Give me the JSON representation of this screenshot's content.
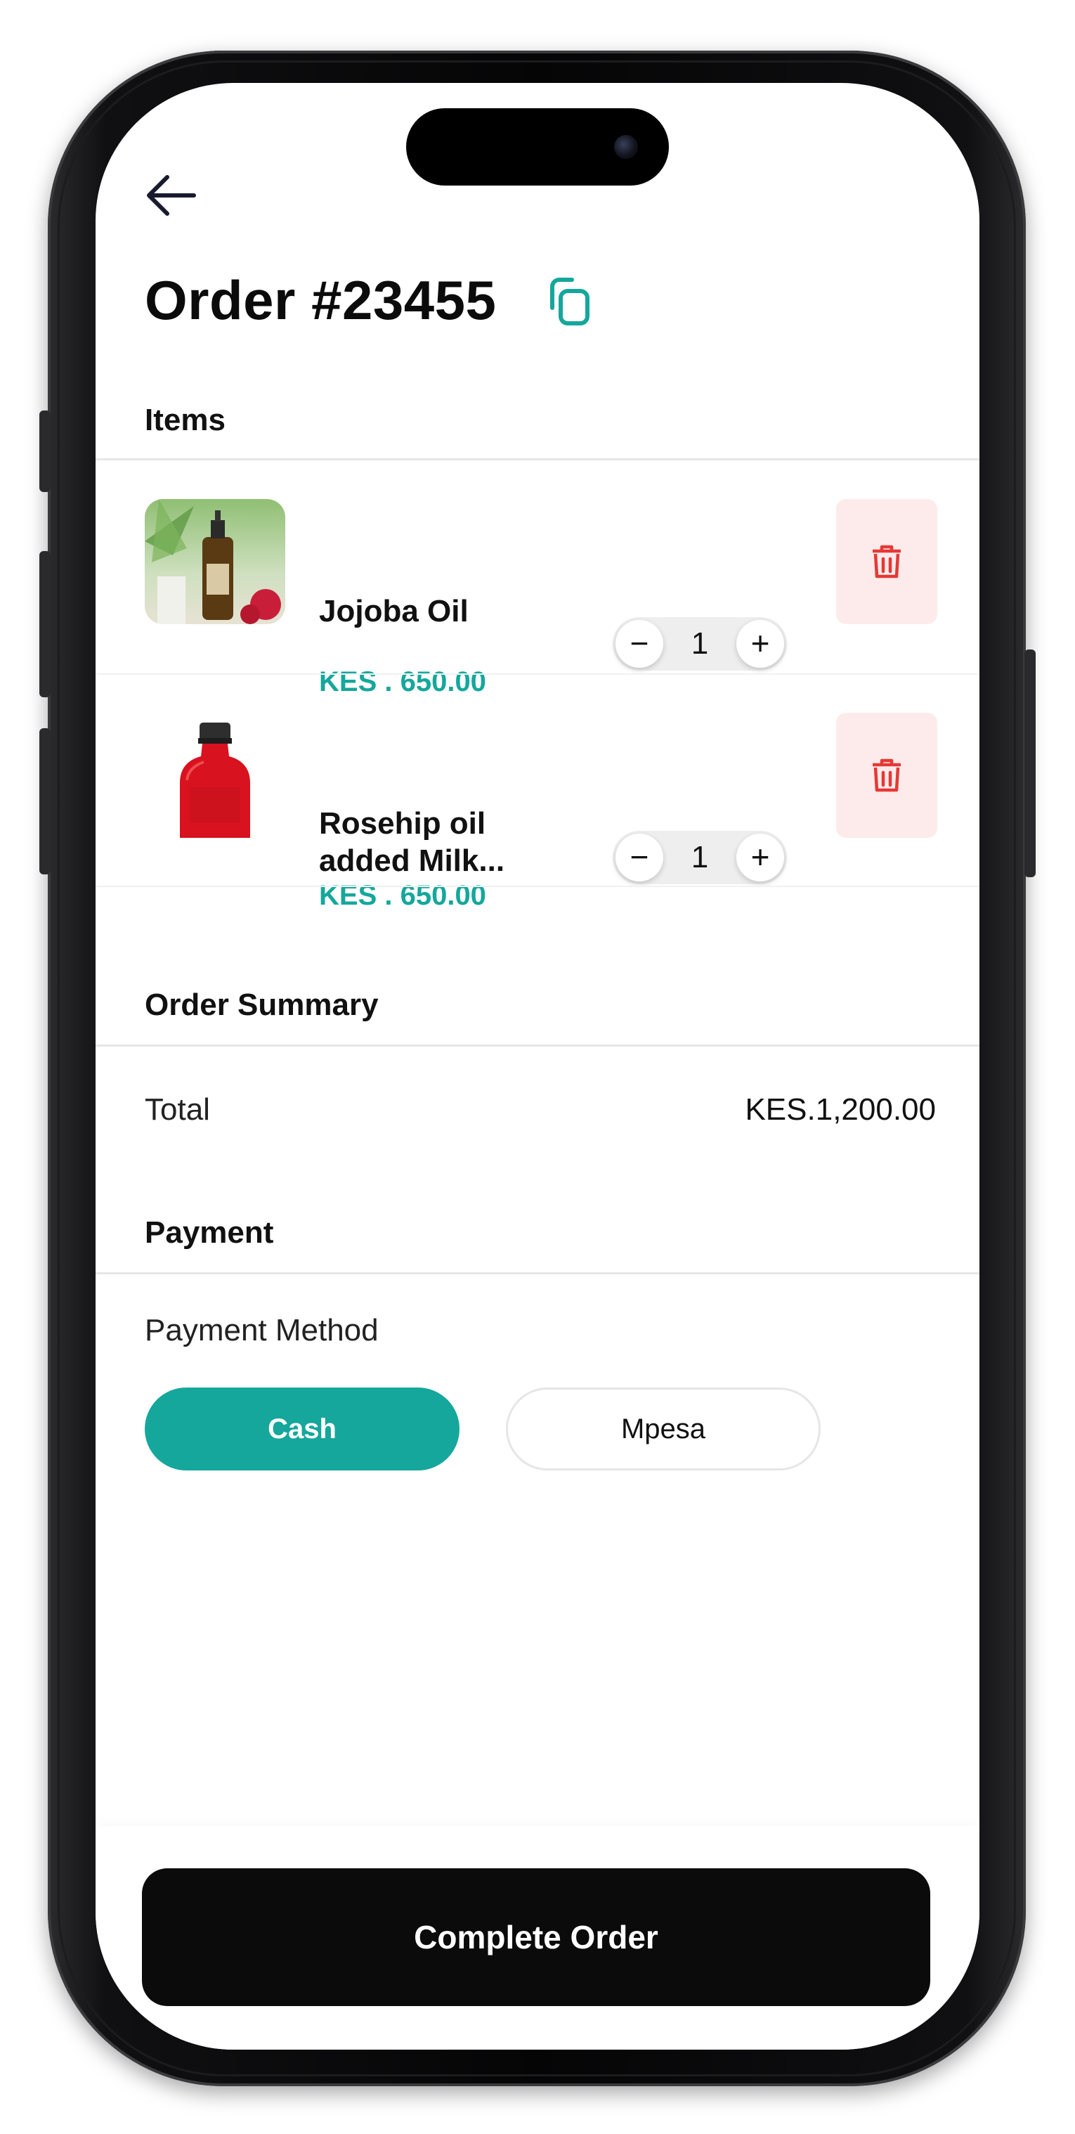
{
  "header": {
    "back_icon": "arrow-left-icon",
    "title": "Order #23455",
    "copy_icon": "copy-icon",
    "accent_color": "#15a79c"
  },
  "items_section": {
    "title": "Items",
    "items": [
      {
        "name": "Jojoba Oil",
        "price": "KES . 650.00",
        "quantity": "1",
        "thumbnail": "jojoba-oil-bottle-image"
      },
      {
        "name": "Rosehip oil added Milk...",
        "price": "KES . 650.00",
        "quantity": "1",
        "thumbnail": "rosehip-oil-bottle-image"
      }
    ],
    "stepper_minus": "−",
    "stepper_plus": "+",
    "delete_icon": "trash-icon",
    "delete_color": "#e53935"
  },
  "summary": {
    "title": "Order Summary",
    "total_label": "Total",
    "total_value": "KES.1,200.00"
  },
  "payment": {
    "title": "Payment",
    "method_label": "Payment Method",
    "options": [
      {
        "label": "Cash",
        "selected": true
      },
      {
        "label": "Mpesa",
        "selected": false
      }
    ]
  },
  "footer": {
    "cta_label": "Complete Order"
  }
}
